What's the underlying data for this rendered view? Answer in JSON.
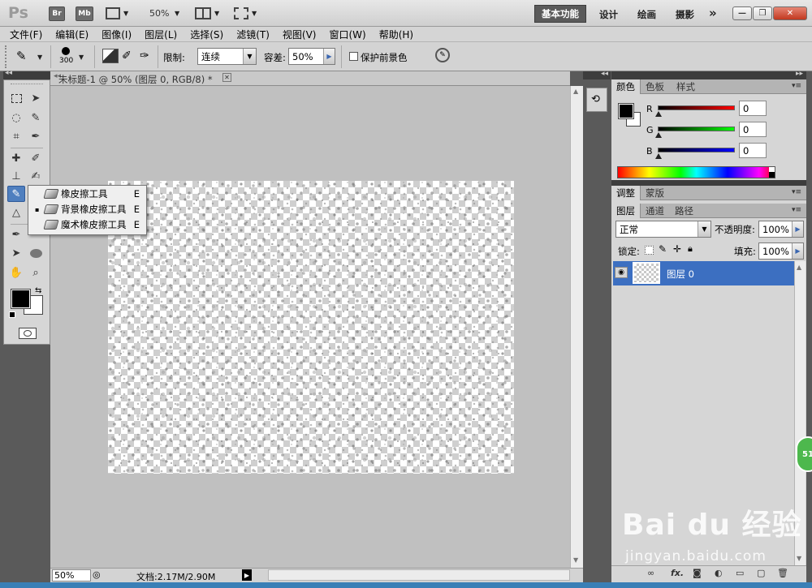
{
  "appbar": {
    "logo": "Ps",
    "br": "Br",
    "mb": "Mb",
    "zoom": "50%",
    "workspaces": [
      "基本功能",
      "设计",
      "绘画",
      "摄影"
    ],
    "more": "»"
  },
  "menu": [
    "文件(F)",
    "编辑(E)",
    "图像(I)",
    "图层(L)",
    "选择(S)",
    "滤镜(T)",
    "视图(V)",
    "窗口(W)",
    "帮助(H)"
  ],
  "options": {
    "brush_size": "300",
    "limit_label": "限制:",
    "limit_value": "连续",
    "tolerance_label": "容差:",
    "tolerance_value": "50%",
    "protect_fg": "保护前景色"
  },
  "document": {
    "tab_title": "未标题-1 @ 50% (图层 0, RGB/8) *",
    "status_zoom": "50%",
    "status_doc": "文档:2.17M/2.90M"
  },
  "flyout": [
    {
      "label": "橡皮擦工具",
      "shortcut": "E"
    },
    {
      "label": "背景橡皮擦工具",
      "shortcut": "E",
      "active": "▪"
    },
    {
      "label": "魔术橡皮擦工具",
      "shortcut": "E"
    }
  ],
  "color_panel": {
    "tabs": [
      "颜色",
      "色板",
      "样式"
    ],
    "r_label": "R",
    "r_value": "0",
    "g_label": "G",
    "g_value": "0",
    "b_label": "B",
    "b_value": "0"
  },
  "adjust_panel": {
    "tabs": [
      "调整",
      "蒙版"
    ]
  },
  "layers_panel": {
    "tabs": [
      "图层",
      "通道",
      "路径"
    ],
    "blend_mode": "正常",
    "opacity_label": "不透明度:",
    "opacity_value": "100%",
    "lock_label": "锁定:",
    "fill_label": "填充:",
    "fill_value": "100%",
    "layers": [
      {
        "name": "图层 0"
      }
    ]
  },
  "watermark": {
    "brand": "Bai du 经验",
    "url": "jingyan.baidu.com"
  },
  "badge": "51"
}
